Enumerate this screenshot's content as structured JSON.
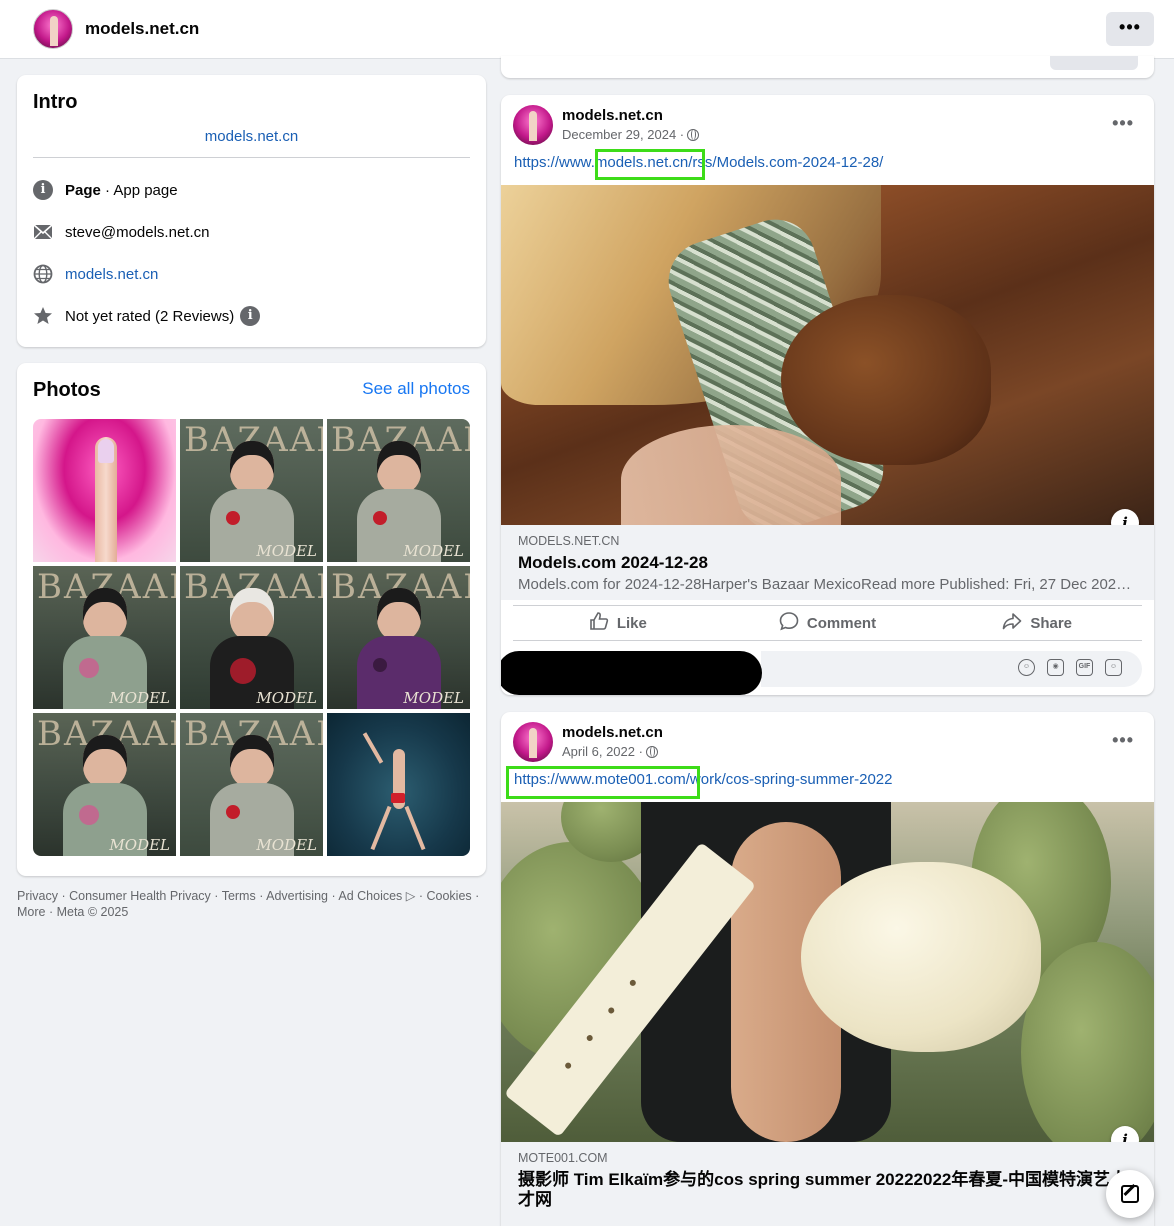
{
  "header": {
    "page_name": "models.net.cn",
    "more_label": "•••"
  },
  "intro": {
    "title": "Intro",
    "bio_link": "models.net.cn",
    "category_bold": "Page",
    "category_rest": " · App page",
    "email": "steve@models.net.cn",
    "website": "models.net.cn",
    "rating": "Not yet rated (2 Reviews)"
  },
  "photos": {
    "title": "Photos",
    "see_all": "See all photos"
  },
  "footer": {
    "text": "Privacy · Consumer Health Privacy · Terms · Advertising · Ad Choices ▷ · Cookies · More · Meta © 2025"
  },
  "posts": [
    {
      "author": "models.net.cn",
      "date": "December 29, 2024 ·",
      "more": "•••",
      "url": "https://www.models.net.cn/rss/Models.com-2024-12-28/",
      "link_domain": "MODELS.NET.CN",
      "link_title": "Models.com 2024-12-28",
      "link_desc": "Models.com for 2024-12-28Harper's Bazaar MexicoRead more Published: Fri, 27 Dec 2024 ...",
      "like": "Like",
      "comment": "Comment",
      "share": "Share"
    },
    {
      "author": "models.net.cn",
      "date": "April 6, 2022 ·",
      "more": "•••",
      "url": "https://www.mote001.com/work/cos-spring-summer-2022",
      "link_domain": "MOTE001.COM",
      "link_title": "摄影师 Tim Elkaïm参与的cos spring summer 20222022年春夏-中国模特演艺人才网"
    }
  ],
  "icons": {
    "info": "info-icon",
    "email": "envelope-icon",
    "website": "globe-icon",
    "rating": "star-icon"
  },
  "colors": {
    "link": "#1a5fb4",
    "highlight": "#3ddc18"
  }
}
